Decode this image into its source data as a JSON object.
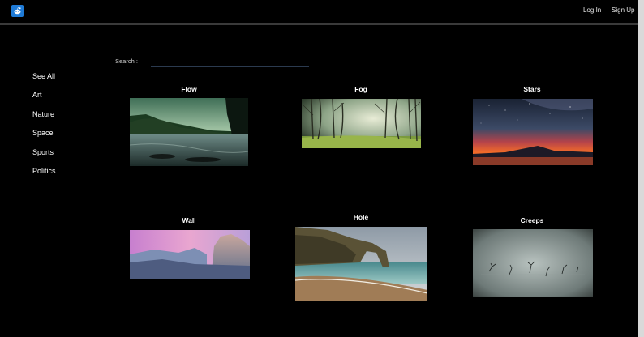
{
  "header": {
    "login_label": "Log In",
    "signup_label": "Sign Up"
  },
  "search": {
    "label": "Search :",
    "placeholder": "",
    "value": ""
  },
  "sidebar": {
    "items": [
      {
        "label": "See All"
      },
      {
        "label": "Art"
      },
      {
        "label": "Nature"
      },
      {
        "label": "Space"
      },
      {
        "label": "Sports"
      },
      {
        "label": "Politics"
      }
    ]
  },
  "gallery": {
    "cards": [
      {
        "title": "Flow"
      },
      {
        "title": "Fog"
      },
      {
        "title": "Stars"
      },
      {
        "title": "Wall"
      },
      {
        "title": "Hole"
      },
      {
        "title": "Creeps"
      }
    ]
  }
}
